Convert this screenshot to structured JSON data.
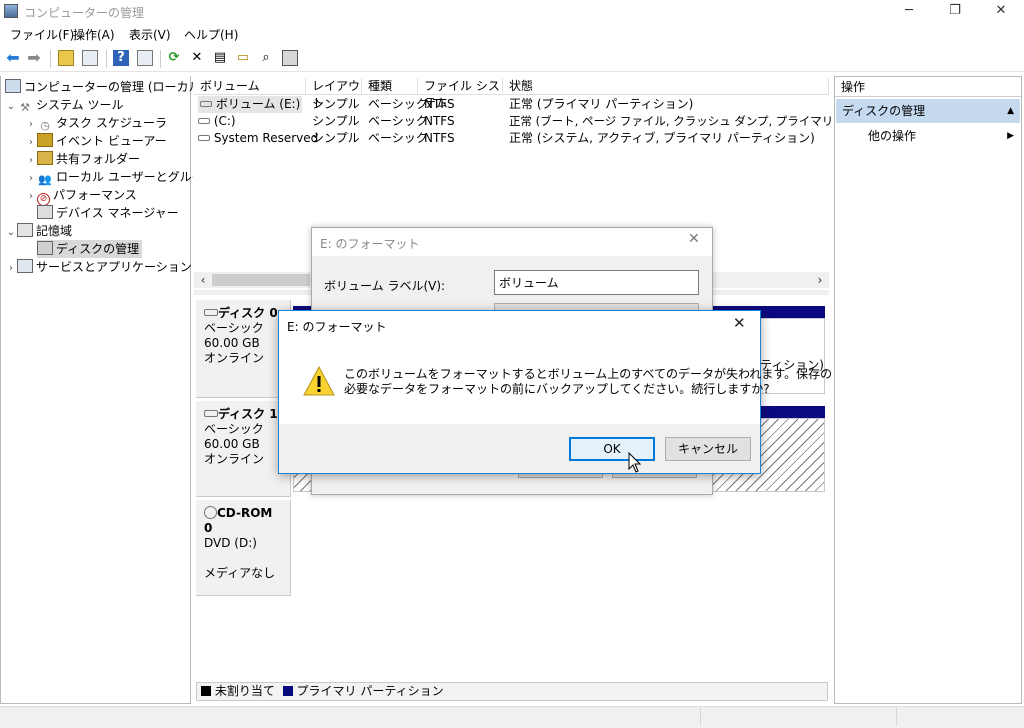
{
  "window": {
    "title": "コンピューターの管理",
    "minimize": "─",
    "maximize": "❐",
    "close": "✕"
  },
  "menu": [
    "ファイル(F)",
    "操作(A)",
    "表示(V)",
    "ヘルプ(H)"
  ],
  "tree": {
    "root": "コンピューターの管理 (ローカル)",
    "system_tools": "システム ツール",
    "task_scheduler": "タスク スケジューラ",
    "event_viewer": "イベント ビューアー",
    "shared_folders": "共有フォルダー",
    "local_users": "ローカル ユーザーとグループ",
    "performance": "パフォーマンス",
    "device_manager": "デバイス マネージャー",
    "storage": "記憶域",
    "disk_management": "ディスクの管理",
    "services": "サービスとアプリケーション"
  },
  "volume_table": {
    "headers": [
      "ボリューム",
      "レイアウト",
      "種類",
      "ファイル システム",
      "状態"
    ],
    "rows": [
      [
        "ボリューム (E:)",
        "シンプル",
        "ベーシック",
        "NTFS",
        "正常 (プライマリ パーティション)"
      ],
      [
        "(C:)",
        "シンプル",
        "ベーシック",
        "NTFS",
        "正常 (ブート, ページ ファイル, クラッシュ ダンプ, プライマリ パーティション)"
      ],
      [
        "System Reserved",
        "シンプル",
        "ベーシック",
        "NTFS",
        "正常 (システム, アクティブ, プライマリ パーティション)"
      ]
    ]
  },
  "disks": [
    {
      "name": "ディスク 0",
      "type": "ベーシック",
      "size": "60.00 GB",
      "status": "オンライン"
    },
    {
      "name": "ディスク 1",
      "type": "ベーシック",
      "size": "60.00 GB",
      "status": "オンライン"
    },
    {
      "name": "CD-ROM 0",
      "type": "DVD (D:)",
      "size": "",
      "status": "メディアなし"
    }
  ],
  "disk0_partition_text": "ーティション)",
  "legend": {
    "unallocated": "未割り当て",
    "primary": "プライマリ パーティション"
  },
  "actions": {
    "header": "操作",
    "section": "ディスクの管理",
    "other": "他の操作"
  },
  "format_dialog": {
    "title": "E: のフォーマット",
    "volume_label": "ボリューム ラベル(V):",
    "volume_value": "ボリューム"
  },
  "confirm_dialog": {
    "title": "E: のフォーマット",
    "line1": "このボリュームをフォーマットするとボリューム上のすべてのデータが失われます。保存の",
    "line2": "必要なデータをフォーマットの前にバックアップしてください。続行しますか?",
    "ok": "OK",
    "cancel": "キャンセル"
  },
  "colors": {
    "primary_partition": "#0a0a80",
    "unallocated": "#000000",
    "accent": "#1883d7",
    "action_header": "#c5d9ef"
  }
}
